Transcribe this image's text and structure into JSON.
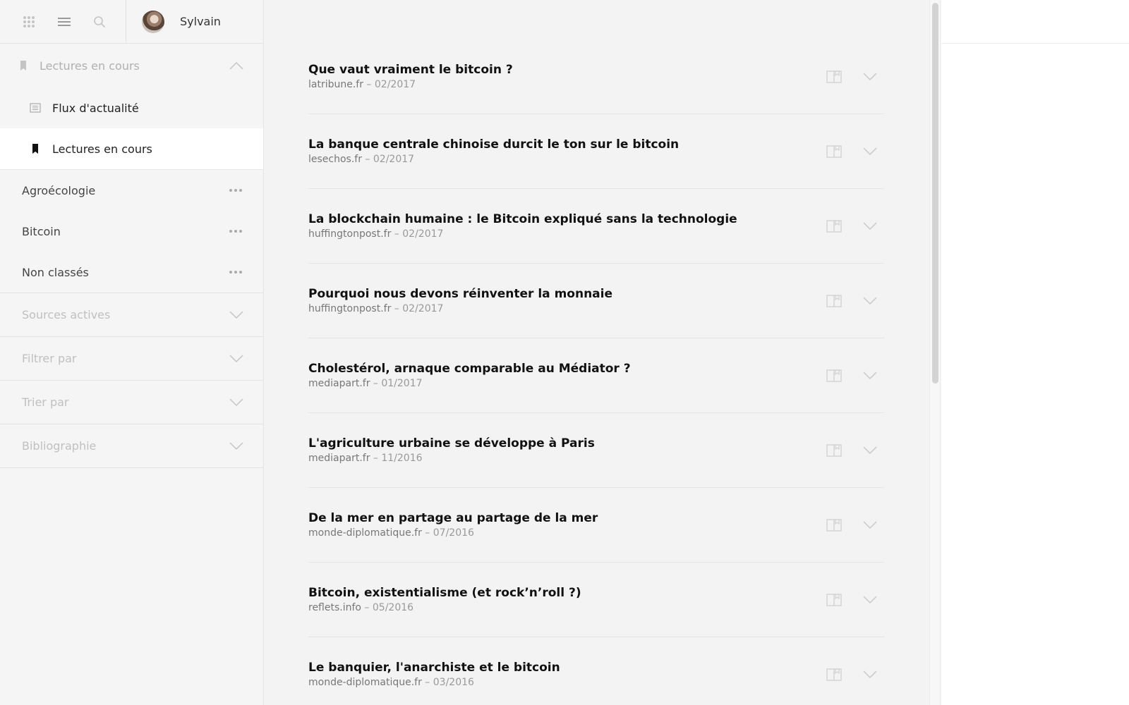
{
  "user": {
    "name": "Sylvain"
  },
  "sidebar": {
    "current_section": "Lectures en cours",
    "sub_items": [
      {
        "label": "Flux d'actualité",
        "icon": "newspaper-icon",
        "active": false
      },
      {
        "label": "Lectures en cours",
        "icon": "bookmark-icon",
        "active": true
      }
    ],
    "folders": [
      {
        "label": "Agroécologie"
      },
      {
        "label": "Bitcoin"
      },
      {
        "label": "Non classés"
      }
    ],
    "collapsibles": [
      {
        "label": "Sources actives"
      },
      {
        "label": "Filtrer par"
      },
      {
        "label": "Trier par"
      },
      {
        "label": "Bibliographie"
      }
    ]
  },
  "articles": [
    {
      "title": "Que vaut vraiment le bitcoin ?",
      "source": "latribune.fr",
      "date": "02/2017"
    },
    {
      "title": "La banque centrale chinoise durcit le ton sur le bitcoin",
      "source": "lesechos.fr",
      "date": "02/2017"
    },
    {
      "title": "La blockchain humaine : le Bitcoin expliqué sans la technologie",
      "source": "huffingtonpost.fr",
      "date": "02/2017"
    },
    {
      "title": "Pourquoi nous devons réinventer la monnaie",
      "source": "huffingtonpost.fr",
      "date": "02/2017"
    },
    {
      "title": "Cholestérol, arnaque comparable au Médiator ?",
      "source": "mediapart.fr",
      "date": "01/2017"
    },
    {
      "title": "L'agriculture urbaine se développe à Paris",
      "source": "mediapart.fr",
      "date": "11/2016"
    },
    {
      "title": "De la mer en partage au partage de la mer",
      "source": "monde-diplomatique.fr",
      "date": "07/2016"
    },
    {
      "title": "Bitcoin, existentialisme (et rock’n’roll ?)",
      "source": "reflets.info",
      "date": "05/2016"
    },
    {
      "title": "Le banquier, l'anarchiste et le bitcoin",
      "source": "monde-diplomatique.fr",
      "date": "03/2016"
    }
  ],
  "colors": {
    "accent": "#111111",
    "muted": "#b0b0b0",
    "sidebar_bg": "#f5f5f5",
    "main_bg": "#f3f3f3"
  }
}
